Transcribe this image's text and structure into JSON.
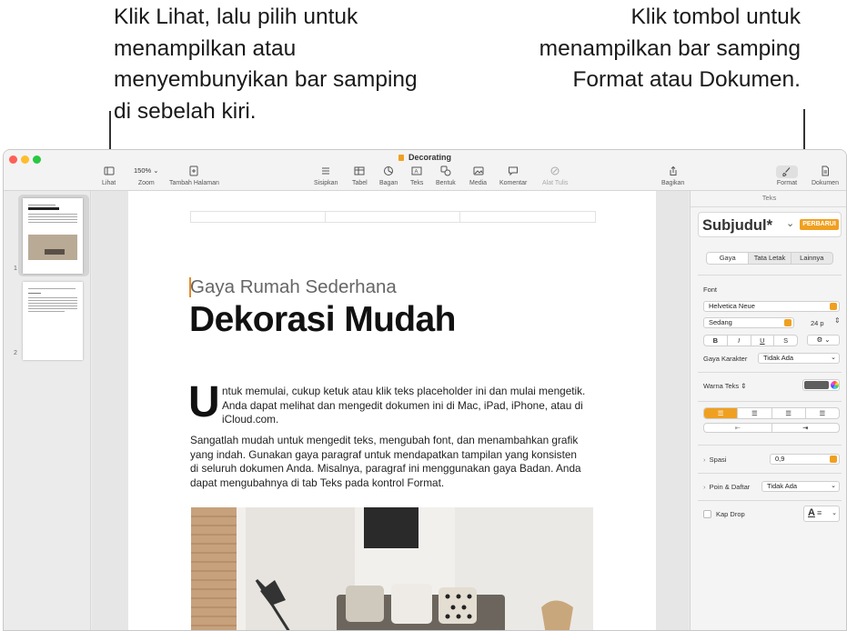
{
  "callouts": {
    "left": "Klik Lihat, lalu pilih untuk menampilkan atau menyembunyikan bar samping di sebelah kiri.",
    "right": "Klik tombol untuk menampilkan bar samping Format atau Dokumen."
  },
  "window": {
    "title": "Decorating"
  },
  "toolbar": {
    "lihat": "Lihat",
    "zoom_value": "150%",
    "zoom": "Zoom",
    "tambah_halaman": "Tambah Halaman",
    "sisipkan": "Sisipkan",
    "tabel": "Tabel",
    "bagan": "Bagan",
    "teks": "Teks",
    "bentuk": "Bentuk",
    "media": "Media",
    "komentar": "Komentar",
    "alat_tulis": "Alat Tulis",
    "bagikan": "Bagikan",
    "format": "Format",
    "dokumen": "Dokumen"
  },
  "sidebar": {
    "pages": [
      "1",
      "2"
    ]
  },
  "document": {
    "subtitle": "Gaya Rumah Sederhana",
    "title": "Dekorasi Mudah",
    "dropcap": "U",
    "para1": "ntuk memulai, cukup ketuk atau klik teks placeholder ini dan mulai mengetik. Anda dapat melihat dan mengedit dokumen ini di Mac, iPad, iPhone, atau di iCloud.com.",
    "para2": "Sangatlah mudah untuk mengedit teks, mengubah font, dan menambahkan grafik yang indah. Gunakan gaya paragraf untuk mendapatkan tampilan yang konsisten di seluruh dokumen Anda. Misalnya, paragraf ini menggunakan gaya Badan. Anda dapat mengubahnya di tab Teks pada kontrol Format."
  },
  "inspector": {
    "header": "Teks",
    "style_name": "Subjudul*",
    "update_button": "PERBARUI",
    "tabs": [
      "Gaya",
      "Tata Letak",
      "Lainnya"
    ],
    "font_label": "Font",
    "font_name": "Helvetica Neue",
    "font_weight": "Sedang",
    "font_size": "24 p",
    "bold": "B",
    "italic": "I",
    "underline": "U",
    "strike": "S",
    "char_style_label": "Gaya Karakter",
    "char_style_value": "Tidak Ada",
    "text_color_label": "Warna Teks",
    "spacing_label": "Spasi",
    "spacing_value": "0,9",
    "bullets_label": "Poin & Daftar",
    "bullets_value": "Tidak Ada",
    "dropcap_label": "Kap Drop",
    "dropcap_preview": "A"
  },
  "colors": {
    "accent": "#f0a020",
    "text_color_swatch": "#5e5e5e"
  }
}
